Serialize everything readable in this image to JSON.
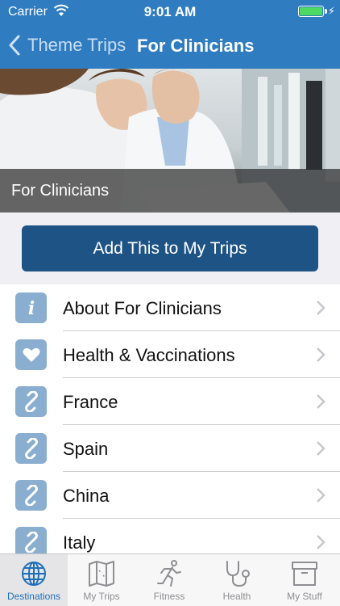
{
  "status": {
    "carrier": "Carrier",
    "time": "9:01 AM"
  },
  "nav": {
    "back_label": "Theme Trips",
    "title": "For Clinicians"
  },
  "hero": {
    "caption": "For Clinicians"
  },
  "add_button": {
    "label": "Add This to My Trips"
  },
  "list": {
    "items": [
      {
        "label": "About For Clinicians",
        "icon": "info-icon"
      },
      {
        "label": "Health & Vaccinations",
        "icon": "heart-icon"
      },
      {
        "label": "France",
        "icon": "link-icon"
      },
      {
        "label": "Spain",
        "icon": "link-icon"
      },
      {
        "label": "China",
        "icon": "link-icon"
      },
      {
        "label": "Italy",
        "icon": "link-icon"
      }
    ]
  },
  "tabbar": {
    "tabs": [
      {
        "label": "Destinations",
        "icon": "globe-icon",
        "active": true
      },
      {
        "label": "My Trips",
        "icon": "map-icon",
        "active": false
      },
      {
        "label": "Fitness",
        "icon": "runner-icon",
        "active": false
      },
      {
        "label": "Health",
        "icon": "stethoscope-icon",
        "active": false
      },
      {
        "label": "My Stuff",
        "icon": "box-icon",
        "active": false
      }
    ]
  },
  "colors": {
    "nav_blue": "#2f7cc0",
    "button_navy": "#1e5485",
    "icon_tile": "#8aaed0",
    "tab_active": "#1f6fb8"
  }
}
